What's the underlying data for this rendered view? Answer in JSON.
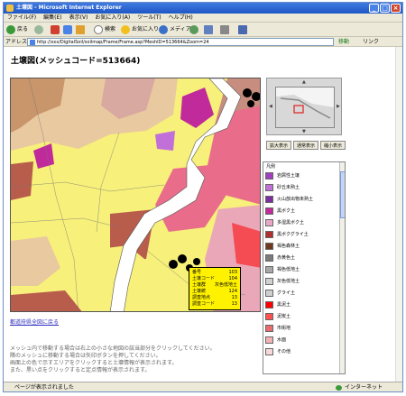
{
  "browser": {
    "title": "土壌図 - Microsoft Internet Explorer",
    "menu": [
      "ファイル(F)",
      "編集(E)",
      "表示(V)",
      "お気に入り(A)",
      "ツール(T)",
      "ヘルプ(H)"
    ],
    "toolbar": {
      "back": "戻る",
      "search": "検索",
      "favorites": "お気に入り",
      "media": "メディア"
    },
    "address_label": "アドレス(D)",
    "address_url": "http://xxx/DigitalSoil/soilmap/Frame/Frame.asp?MeshID=513664&Zoom=24",
    "go_label": "移動",
    "links_label": "リンク",
    "status_text": "ページが表示されました",
    "zone_text": "インターネット"
  },
  "page": {
    "title": "土壌図(メッシュコード=513664)",
    "back_link": "都道府県全図に戻る",
    "instructions": [
      "メッシュ内で移動する場合は右上の小さな地図の該当部分をクリックしてください。",
      "隣のメッシュに移動する場合は矢印ボタンを押してください。",
      "画面上の色で示すエリアをクリックすると土壌情報が表示されます。",
      "また、黒い点をクリックすると定点情報が表示されます。"
    ]
  },
  "map_buttons": [
    "拡大表示",
    "通常表示",
    "縮小表示"
  ],
  "callout": {
    "rows": [
      {
        "k": "番号",
        "v": "103"
      },
      {
        "k": "土壌コード",
        "v": "104"
      },
      {
        "k": "土壌群",
        "v": "灰色低地土"
      },
      {
        "k": "土壌統",
        "v": "124"
      },
      {
        "k": "調査地点",
        "v": "13"
      },
      {
        "k": "調査コード",
        "v": "13"
      }
    ]
  },
  "legend": {
    "header": "凡例",
    "items": [
      {
        "label": "岩屑性土壌",
        "color": "#a040c0"
      },
      {
        "label": "砂丘未熟土",
        "color": "#c070d8"
      },
      {
        "label": "火山放出物未熟土",
        "color": "#7d2ea0"
      },
      {
        "label": "黒ボク土",
        "color": "#c02a9a"
      },
      {
        "label": "多湿黒ボク土",
        "color": "#e9a7c8"
      },
      {
        "label": "黒ボクグライ土",
        "color": "#b03030"
      },
      {
        "label": "褐色森林土",
        "color": "#6d3a20"
      },
      {
        "label": "赤黄色土",
        "color": "#7a7a7a"
      },
      {
        "label": "褐色低地土",
        "color": "#a8a8a8"
      },
      {
        "label": "灰色低地土",
        "color": "#d0d0d0"
      },
      {
        "label": "グライ土",
        "color": "#cfcfcf"
      },
      {
        "label": "黒泥土",
        "color": "#ff0000"
      },
      {
        "label": "泥炭土",
        "color": "#ff5050"
      },
      {
        "label": "市街地",
        "color": "#e86d6d"
      },
      {
        "label": "水面",
        "color": "#f4b3b3"
      },
      {
        "label": "その他",
        "color": "#f8d8d8"
      }
    ]
  },
  "colors": {
    "soil_yellow": "#f7f07a",
    "river": "#ffffff",
    "pink": "#e96d8a",
    "magenta": "#c02a9a",
    "brown": "#b85c4c"
  }
}
